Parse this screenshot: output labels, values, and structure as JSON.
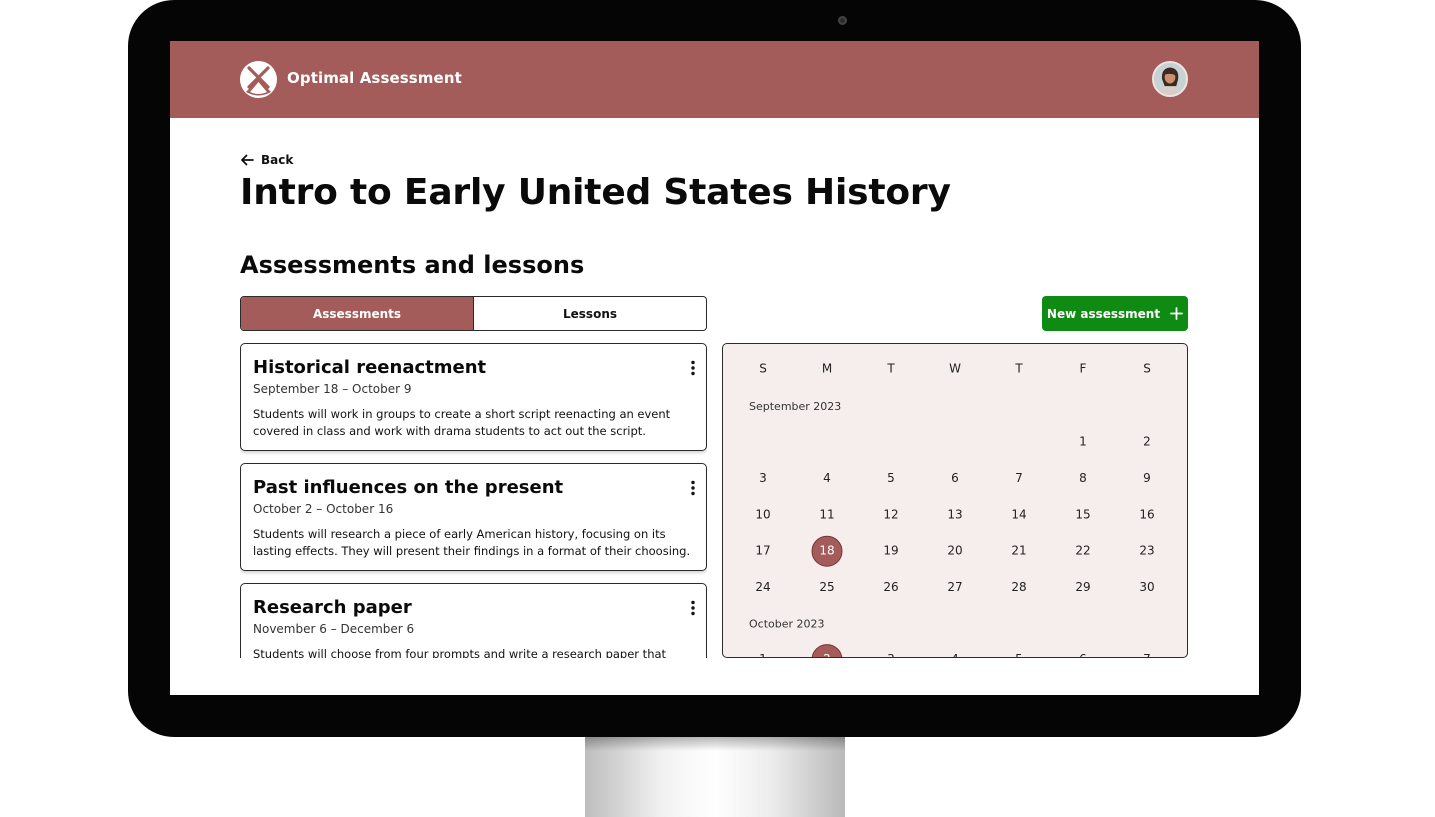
{
  "app": {
    "name": "Optimal Assessment"
  },
  "nav": {
    "back_label": "Back"
  },
  "page": {
    "title": "Intro to Early United States History",
    "section_title": "Assessments and lessons"
  },
  "tabs": [
    {
      "label": "Assessments",
      "active": true
    },
    {
      "label": "Lessons",
      "active": false
    }
  ],
  "actions": {
    "new_assessment_label": "New assessment"
  },
  "assessments": [
    {
      "title": "Historical reenactment",
      "dates": "September 18 – October 9",
      "description": "Students will work in groups to create a short script reenacting an event covered in class and work with drama students to act out the script."
    },
    {
      "title": "Past influences on the present",
      "dates": "October 2 – October 16",
      "description": "Students will research a piece of early American history, focusing on its lasting effects. They will present their findings in a format of their choosing."
    },
    {
      "title": "Research paper",
      "dates": "November 6 – December 6",
      "description": "Students will choose from four prompts and write a research paper that"
    }
  ],
  "calendar": {
    "weekdays": [
      "S",
      "M",
      "T",
      "W",
      "T",
      "F",
      "S"
    ],
    "months": [
      {
        "label": "September 2023",
        "first_weekday": 5,
        "days": 30,
        "highlighted": [
          18
        ]
      },
      {
        "label": "October 2023",
        "first_weekday": 0,
        "days": 7,
        "highlighted": [
          2
        ]
      }
    ]
  },
  "colors": {
    "brand": "#a35c5a",
    "primary_action": "#0f8a12",
    "calendar_bg": "#f6eeed",
    "highlight": "#a35c5a"
  },
  "icons": {
    "logo": "crossed-swords-logo-icon",
    "back": "arrow-left-icon",
    "add": "plus-icon",
    "menu": "kebab-menu-icon",
    "avatar": "user-avatar"
  }
}
